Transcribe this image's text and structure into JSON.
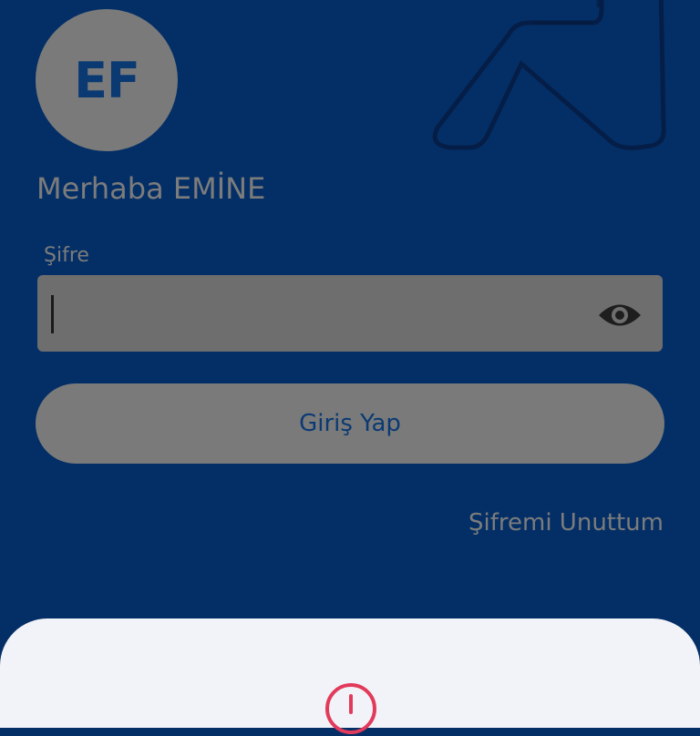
{
  "user": {
    "initials": "EF",
    "greeting": "Merhaba EMİNE"
  },
  "password": {
    "label": "Şifre",
    "value": "",
    "placeholder": ""
  },
  "actions": {
    "login_label": "Giriş Yap",
    "forgot_label": "Şifremi Unuttum"
  },
  "icons": {
    "visibility": "eye-icon",
    "alert": "alert-circle-icon",
    "brand": "brand-logo"
  },
  "colors": {
    "background": "#042f66",
    "overlay_gray": "#7a7a7a",
    "text_on_gray": "#0b3a73",
    "sheet": "#f2f3f8",
    "alert": "#e23a5a"
  }
}
